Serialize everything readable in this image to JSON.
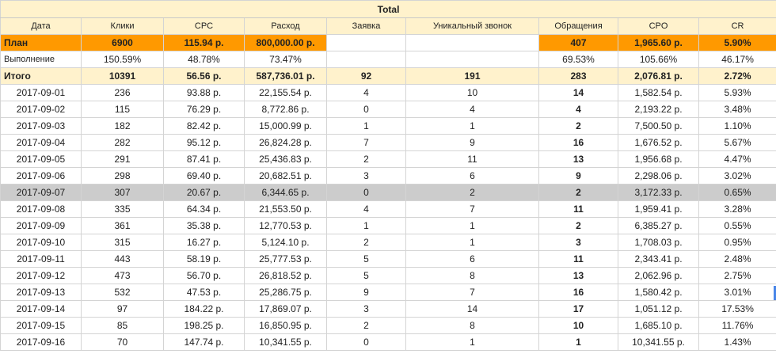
{
  "title": "Total",
  "headers": [
    "Дата",
    "Клики",
    "CPC",
    "Расход",
    "Заявка",
    "Уникальный звонок",
    "Обращения",
    "CPO",
    "CR"
  ],
  "plan": {
    "label": "План",
    "clicks": "6900",
    "cpc": "115.94 р.",
    "spend": "800,000.00 р.",
    "requests": "",
    "calls": "",
    "contacts": "407",
    "cpo": "1,965.60 р.",
    "cr": "5.90%"
  },
  "performance": {
    "label": "Выполнение",
    "clicks": "150.59%",
    "cpc": "48.78%",
    "spend": "73.47%",
    "requests": "",
    "calls": "",
    "contacts": "69.53%",
    "cpo": "105.66%",
    "cr": "46.17%"
  },
  "total": {
    "label": "Итого",
    "clicks": "10391",
    "cpc": "56.56 р.",
    "spend": "587,736.01 р.",
    "requests": "92",
    "calls": "191",
    "contacts": "283",
    "cpo": "2,076.81 р.",
    "cr": "2.72%"
  },
  "rows": [
    {
      "date": "2017-09-01",
      "clicks": "236",
      "cpc": "93.88 р.",
      "spend": "22,155.54 р.",
      "requests": "4",
      "calls": "10",
      "contacts": "14",
      "cpo": "1,582.54 р.",
      "cr": "5.93%"
    },
    {
      "date": "2017-09-02",
      "clicks": "115",
      "cpc": "76.29 р.",
      "spend": "8,772.86 р.",
      "requests": "0",
      "calls": "4",
      "contacts": "4",
      "cpo": "2,193.22 р.",
      "cr": "3.48%"
    },
    {
      "date": "2017-09-03",
      "clicks": "182",
      "cpc": "82.42 р.",
      "spend": "15,000.99 р.",
      "requests": "1",
      "calls": "1",
      "contacts": "2",
      "cpo": "7,500.50 р.",
      "cr": "1.10%"
    },
    {
      "date": "2017-09-04",
      "clicks": "282",
      "cpc": "95.12 р.",
      "spend": "26,824.28 р.",
      "requests": "7",
      "calls": "9",
      "contacts": "16",
      "cpo": "1,676.52 р.",
      "cr": "5.67%"
    },
    {
      "date": "2017-09-05",
      "clicks": "291",
      "cpc": "87.41 р.",
      "spend": "25,436.83 р.",
      "requests": "2",
      "calls": "11",
      "contacts": "13",
      "cpo": "1,956.68 р.",
      "cr": "4.47%"
    },
    {
      "date": "2017-09-06",
      "clicks": "298",
      "cpc": "69.40 р.",
      "spend": "20,682.51 р.",
      "requests": "3",
      "calls": "6",
      "contacts": "9",
      "cpo": "2,298.06 р.",
      "cr": "3.02%"
    },
    {
      "date": "2017-09-07",
      "clicks": "307",
      "cpc": "20.67 р.",
      "spend": "6,344.65 р.",
      "requests": "0",
      "calls": "2",
      "contacts": "2",
      "cpo": "3,172.33 р.",
      "cr": "0.65%"
    },
    {
      "date": "2017-09-08",
      "clicks": "335",
      "cpc": "64.34 р.",
      "spend": "21,553.50 р.",
      "requests": "4",
      "calls": "7",
      "contacts": "11",
      "cpo": "1,959.41 р.",
      "cr": "3.28%"
    },
    {
      "date": "2017-09-09",
      "clicks": "361",
      "cpc": "35.38 р.",
      "spend": "12,770.53 р.",
      "requests": "1",
      "calls": "1",
      "contacts": "2",
      "cpo": "6,385.27 р.",
      "cr": "0.55%"
    },
    {
      "date": "2017-09-10",
      "clicks": "315",
      "cpc": "16.27 р.",
      "spend": "5,124.10 р.",
      "requests": "2",
      "calls": "1",
      "contacts": "3",
      "cpo": "1,708.03 р.",
      "cr": "0.95%"
    },
    {
      "date": "2017-09-11",
      "clicks": "443",
      "cpc": "58.19 р.",
      "spend": "25,777.53 р.",
      "requests": "5",
      "calls": "6",
      "contacts": "11",
      "cpo": "2,343.41 р.",
      "cr": "2.48%"
    },
    {
      "date": "2017-09-12",
      "clicks": "473",
      "cpc": "56.70 р.",
      "spend": "26,818.52 р.",
      "requests": "5",
      "calls": "8",
      "contacts": "13",
      "cpo": "2,062.96 р.",
      "cr": "2.75%"
    },
    {
      "date": "2017-09-13",
      "clicks": "532",
      "cpc": "47.53 р.",
      "spend": "25,286.75 р.",
      "requests": "9",
      "calls": "7",
      "contacts": "16",
      "cpo": "1,580.42 р.",
      "cr": "3.01%"
    },
    {
      "date": "2017-09-14",
      "clicks": "97",
      "cpc": "184.22 р.",
      "spend": "17,869.07 р.",
      "requests": "3",
      "calls": "14",
      "contacts": "17",
      "cpo": "1,051.12 р.",
      "cr": "17.53%"
    },
    {
      "date": "2017-09-15",
      "clicks": "85",
      "cpc": "198.25 р.",
      "spend": "16,850.95 р.",
      "requests": "2",
      "calls": "8",
      "contacts": "10",
      "cpo": "1,685.10 р.",
      "cr": "11.76%"
    },
    {
      "date": "2017-09-16",
      "clicks": "70",
      "cpc": "147.74 р.",
      "spend": "10,341.55 р.",
      "requests": "0",
      "calls": "1",
      "contacts": "1",
      "cpo": "10,341.55 р.",
      "cr": "1.43%"
    }
  ],
  "colors": {
    "header_bg": "#fff2cc",
    "plan_bg": "#ff9900",
    "selected_row_bg": "#cccccc",
    "grid": "#d4d4d4"
  }
}
